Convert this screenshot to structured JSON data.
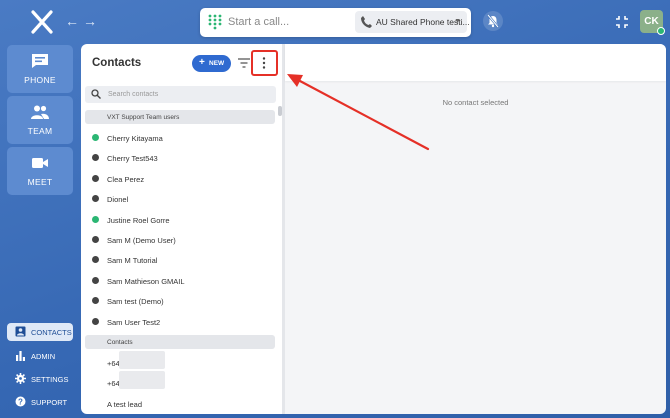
{
  "topbar": {
    "dial_placeholder": "Start a call...",
    "phone_line": "AU Shared Phone testi...",
    "avatar_initials": "CK"
  },
  "nav": {
    "tiles": [
      {
        "label": "PHONE",
        "icon": "phone-chat-icon"
      },
      {
        "label": "TEAM",
        "icon": "team-icon"
      },
      {
        "label": "MEET",
        "icon": "video-camera-icon"
      }
    ],
    "links": [
      {
        "label": "CONTACTS",
        "icon": "contacts-icon",
        "active": true
      },
      {
        "label": "ADMIN",
        "icon": "bar-chart-icon"
      },
      {
        "label": "SETTINGS",
        "icon": "gear-icon"
      },
      {
        "label": "SUPPORT",
        "icon": "help-icon"
      }
    ]
  },
  "contacts": {
    "title": "Contacts",
    "new_label": "NEW",
    "search_placeholder": "Search contacts",
    "groups": [
      {
        "header": "VXT Support Team users",
        "items": [
          {
            "name": "Cherry Kitayama",
            "online": true
          },
          {
            "name": "Cherry Test543",
            "online": false
          },
          {
            "name": "Clea Perez",
            "online": false
          },
          {
            "name": "Dionel",
            "online": false
          },
          {
            "name": "Justine Roel Gorre",
            "online": true
          },
          {
            "name": "Sam M (Demo User)",
            "online": false
          },
          {
            "name": "Sam M Tutorial",
            "online": false
          },
          {
            "name": "Sam Mathieson GMAIL",
            "online": false
          },
          {
            "name": "Sam test (Demo)",
            "online": false
          },
          {
            "name": "Sam User Test2",
            "online": false
          }
        ]
      },
      {
        "header": "Contacts",
        "items": [
          {
            "name": "+64"
          },
          {
            "name": "+64"
          },
          {
            "name": "A test lead"
          }
        ]
      }
    ]
  },
  "detail": {
    "empty_text": "No contact selected"
  },
  "colors": {
    "accent": "#2f6ad0",
    "online": "#2bb673",
    "annotation": "#e53027"
  }
}
